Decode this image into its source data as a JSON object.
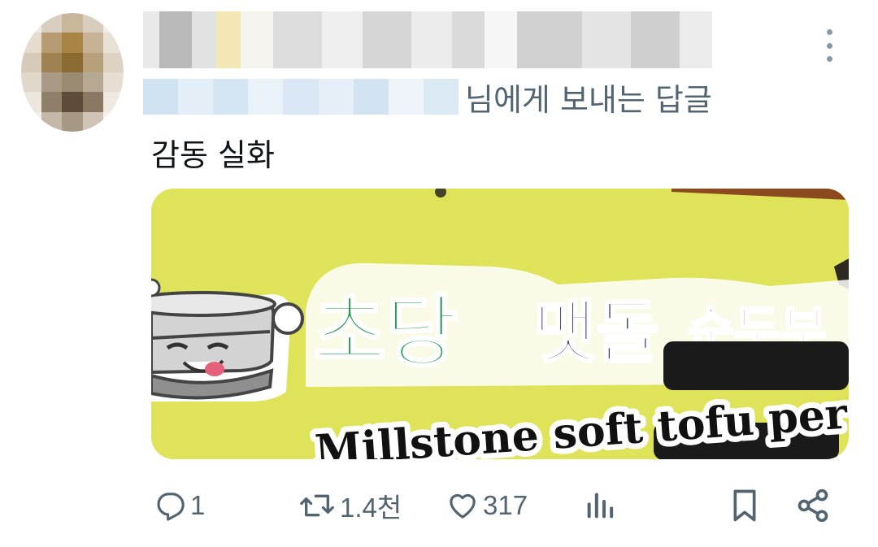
{
  "tweet": {
    "reply_suffix": "님에게 보내는 답글",
    "text": "감동 실화",
    "media": {
      "sign_text_english": "Millstone soft tofu per second",
      "sign_text_korean_green": "초당",
      "sign_text_korean_navy": "맷돌",
      "sign_text_korean_red": "순두부"
    }
  },
  "actions": {
    "reply_count": "1",
    "retweet_count": "1.4천",
    "like_count": "317"
  },
  "colors": {
    "icon_gray": "#536471",
    "text_primary": "#0f1419",
    "sign_yellow": "#dfe35a",
    "sign_green": "#1f9a4a",
    "sign_navy": "#1e2a7a",
    "sign_red": "#e0263a"
  },
  "icons": {
    "reply": "reply-icon",
    "retweet": "retweet-icon",
    "like": "heart-icon",
    "views": "analytics-icon",
    "bookmark": "bookmark-icon",
    "share": "share-icon",
    "more": "more-icon"
  }
}
